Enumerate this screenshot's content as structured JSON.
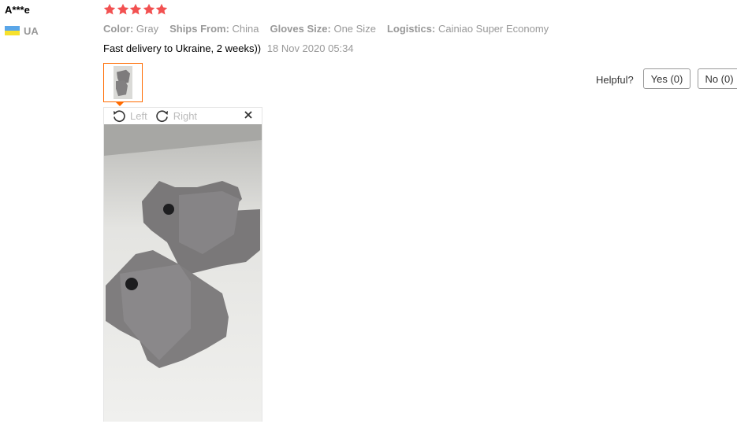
{
  "user": {
    "name": "A***e",
    "country_code": "UA"
  },
  "rating": {
    "stars": 5,
    "max": 5,
    "star_color": "#f25151"
  },
  "attributes": [
    {
      "key": "Color:",
      "value": "Gray"
    },
    {
      "key": "Ships From:",
      "value": "China"
    },
    {
      "key": "Gloves Size:",
      "value": "One Size"
    },
    {
      "key": "Logistics:",
      "value": "Cainiao Super Economy"
    }
  ],
  "review": {
    "text": "Fast delivery to Ukraine, 2 weeks))",
    "date": "18 Nov 2020 05:34"
  },
  "helpful": {
    "label": "Helpful?",
    "yes_label": "Yes (0)",
    "no_label": "No (0)"
  },
  "viewer": {
    "rotate_left_label": "Left",
    "rotate_right_label": "Right"
  },
  "colors": {
    "accent": "#ff6a00",
    "muted_text": "#999999",
    "flag_blue": "#5aa6e8",
    "flag_yellow": "#f7e12c"
  }
}
